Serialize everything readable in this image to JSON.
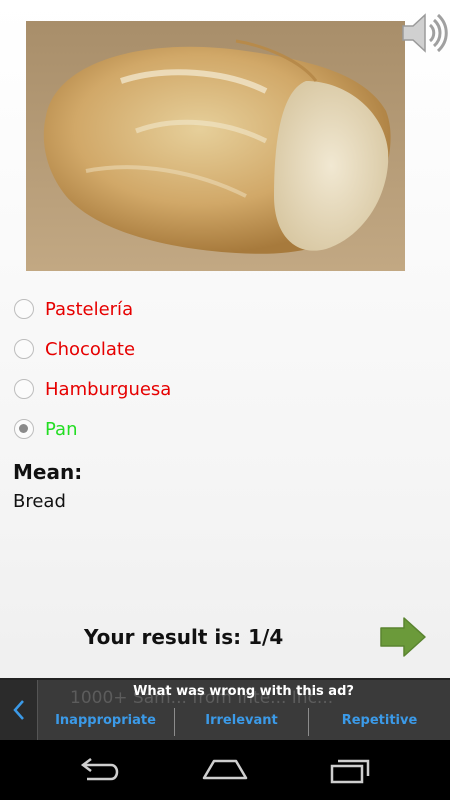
{
  "question": {
    "image_subject": "bread loaf photo",
    "sound_icon": "speaker-volume-icon"
  },
  "options": [
    {
      "label": "Pastelería",
      "selected": false,
      "state": "wrong"
    },
    {
      "label": "Chocolate",
      "selected": false,
      "state": "wrong"
    },
    {
      "label": "Hamburguesa",
      "selected": false,
      "state": "wrong"
    },
    {
      "label": "Pan",
      "selected": true,
      "state": "correct"
    }
  ],
  "meaning": {
    "heading": "Mean:",
    "value": "Bread"
  },
  "result": {
    "text": "Your result is: 1/4"
  },
  "ad": {
    "question": "What was wrong with this ad?",
    "background_text": "1000+ Sam... from Inte... Inc...",
    "choices": [
      "Inappropriate",
      "Irrelevant",
      "Repetitive"
    ]
  },
  "colors": {
    "wrong": "#e60000",
    "correct": "#22dd22",
    "next_arrow": "#6b9a3a",
    "ad_link": "#3b9ae8"
  },
  "nav": {
    "icons": [
      "back-icon",
      "home-icon",
      "recent-apps-icon"
    ]
  }
}
